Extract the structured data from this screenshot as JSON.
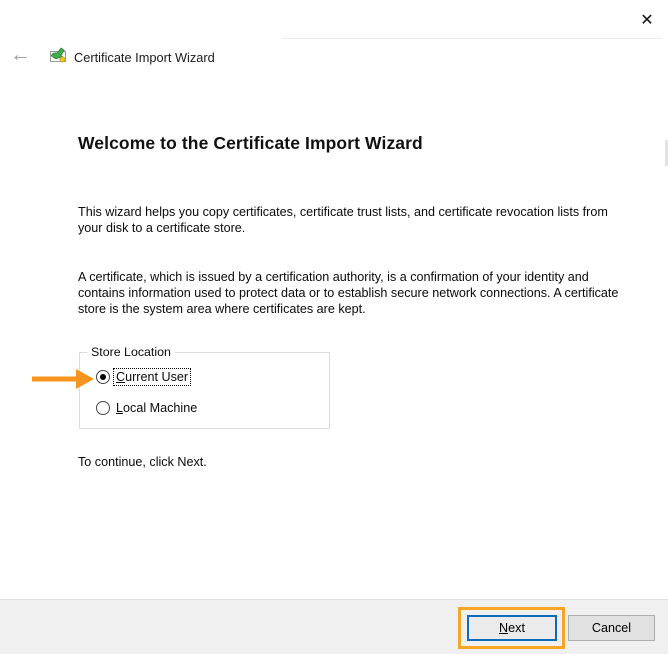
{
  "window": {
    "title": "Certificate Import Wizard",
    "icons": {
      "close": "✕",
      "back": "←",
      "app": "certificate-import-icon"
    }
  },
  "main": {
    "heading": "Welcome to the Certificate Import Wizard",
    "paragraph1": "This wizard helps you copy certificates, certificate trust lists, and certificate revocation lists from your disk to a certificate store.",
    "paragraph2": "A certificate, which is issued by a certification authority, is a confirmation of your identity and contains information used to protect data or to establish secure network connections. A certificate store is the system area where certificates are kept.",
    "instruction": "To continue, click Next."
  },
  "store_location": {
    "legend": "Store Location",
    "options": [
      {
        "accel": "C",
        "rest": "urrent User",
        "selected": true,
        "focused": true
      },
      {
        "accel": "L",
        "rest": "ocal Machine",
        "selected": false,
        "focused": false
      }
    ]
  },
  "annotations": {
    "arrow_color": "#F7941D",
    "highlight_color": "#F5A623",
    "arrow_target": "Current User radio",
    "highlight_target": "Next button"
  },
  "footer": {
    "next": {
      "accel": "N",
      "rest": "ext"
    },
    "cancel_label": "Cancel"
  }
}
